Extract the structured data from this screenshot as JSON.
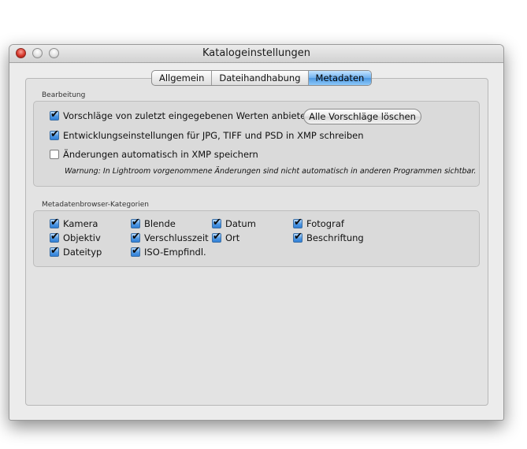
{
  "window": {
    "title": "Katalogeinstellungen"
  },
  "tabs": [
    {
      "label": "Allgemein",
      "active": false
    },
    {
      "label": "Dateihandhabung",
      "active": false
    },
    {
      "label": "Metadaten",
      "active": true
    }
  ],
  "editing": {
    "section_label": "Bearbeitung",
    "options": [
      {
        "label": "Vorschläge von zuletzt eingegebenen Werten anbieten",
        "checked": true
      },
      {
        "label": "Entwicklungseinstellungen für JPG, TIFF und PSD in XMP schreiben",
        "checked": true
      },
      {
        "label": "Änderungen automatisch in XMP speichern",
        "checked": false
      }
    ],
    "clear_button_label": "Alle Vorschläge löschen",
    "warning": "Warnung: In Lightroom vorgenommene Änderungen sind nicht automatisch in anderen Programmen sichtbar."
  },
  "browser_categories": {
    "section_label": "Metadatenbrowser-Kategorien",
    "items": [
      {
        "label": "Kamera",
        "checked": true
      },
      {
        "label": "Objektiv",
        "checked": true
      },
      {
        "label": "Dateityp",
        "checked": true
      },
      {
        "label": "Blende",
        "checked": true
      },
      {
        "label": "Verschlusszeit",
        "checked": true
      },
      {
        "label": "ISO-Empfindl.",
        "checked": true
      },
      {
        "label": "Datum",
        "checked": true
      },
      {
        "label": "Ort",
        "checked": true
      },
      {
        "label": "Fotograf",
        "checked": true
      },
      {
        "label": "Beschriftung",
        "checked": true
      }
    ]
  },
  "check_glyph": "✔",
  "colors": {
    "accent": "#4e98e0",
    "window_bg": "#ececec",
    "close_button": "#d7382c"
  }
}
